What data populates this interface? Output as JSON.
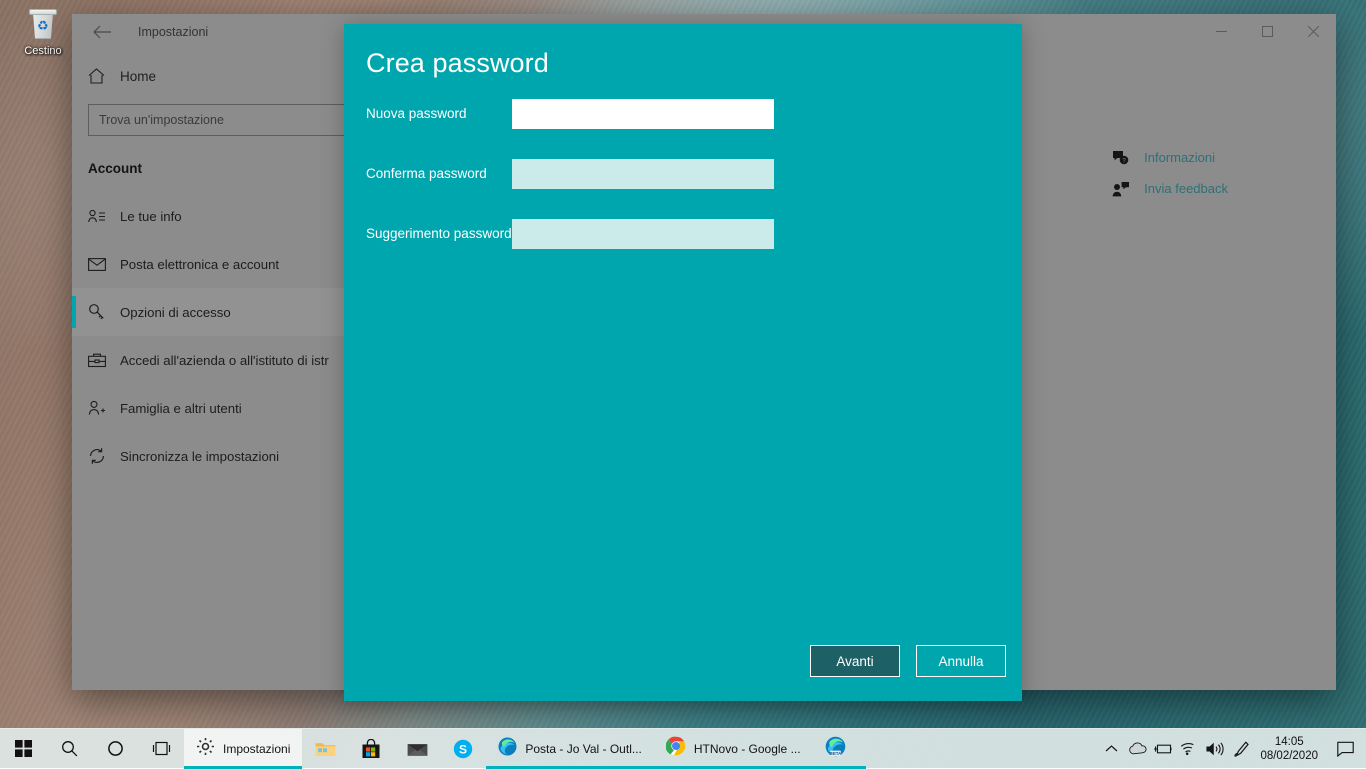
{
  "desktop": {
    "icons": [
      {
        "name": "recycle-bin",
        "label": "Cestino"
      }
    ]
  },
  "settings_window": {
    "title": "Impostazioni",
    "back_icon": "back-arrow-icon",
    "caption": {
      "minimize": "minimize-icon",
      "maximize": "maximize-icon",
      "close": "close-icon"
    },
    "home": {
      "label": "Home",
      "icon": "home-icon"
    },
    "search": {
      "placeholder": "Trova un'impostazione",
      "icon": "search-icon"
    },
    "section_title": "Account",
    "nav_items": [
      {
        "label": "Le tue info",
        "icon": "person-info-icon",
        "selected": false
      },
      {
        "label": "Posta elettronica e account",
        "icon": "mail-icon",
        "selected": false
      },
      {
        "label": "Opzioni di accesso",
        "icon": "key-icon",
        "selected": true
      },
      {
        "label": "Accedi all'azienda o all'istituto di istr",
        "icon": "briefcase-icon",
        "selected": false
      },
      {
        "label": "Famiglia e altri utenti",
        "icon": "add-person-icon",
        "selected": false
      },
      {
        "label": "Sincronizza le impostazioni",
        "icon": "sync-icon",
        "selected": false
      }
    ],
    "help_links": [
      {
        "label": "Informazioni",
        "icon": "question-bubble-icon"
      },
      {
        "label": "Invia feedback",
        "icon": "feedback-person-icon"
      }
    ]
  },
  "dialog": {
    "title": "Crea password",
    "accent_color": "#00a6ad",
    "field_bg": "#cbeaea",
    "focused_field_bg": "#ffffff",
    "fields": [
      {
        "label": "Nuova password",
        "value": "",
        "placeholder": "",
        "focused": true
      },
      {
        "label": "Conferma password",
        "value": "",
        "placeholder": "",
        "focused": false
      },
      {
        "label": "Suggerimento password",
        "value": "",
        "placeholder": "",
        "focused": false
      }
    ],
    "buttons": {
      "primary": "Avanti",
      "secondary": "Annulla"
    }
  },
  "taskbar": {
    "start_icon": "windows-start-icon",
    "search_icon": "search-icon",
    "cortana_icon": "cortana-circle-icon",
    "taskview_icon": "task-view-icon",
    "active_app": {
      "label": "Impostazioni",
      "icon": "gear-icon"
    },
    "pinned": [
      {
        "name": "file-explorer-icon"
      },
      {
        "name": "microsoft-store-icon"
      },
      {
        "name": "mail-icon"
      },
      {
        "name": "skype-icon"
      }
    ],
    "open_apps": [
      {
        "label": "Posta - Jo Val - Outl...",
        "icon": "edge-icon"
      },
      {
        "label": "HTNovo - Google ...",
        "icon": "chrome-icon"
      },
      {
        "label": "",
        "icon": "edge-beta-icon"
      }
    ],
    "tray": [
      {
        "name": "chevron-up-icon"
      },
      {
        "name": "onedrive-cloud-icon"
      },
      {
        "name": "battery-icon"
      },
      {
        "name": "wifi-icon"
      },
      {
        "name": "volume-icon"
      },
      {
        "name": "pen-ink-icon"
      }
    ],
    "clock": {
      "time": "14:05",
      "date": "08/02/2020"
    },
    "action_center_icon": "notification-icon"
  }
}
